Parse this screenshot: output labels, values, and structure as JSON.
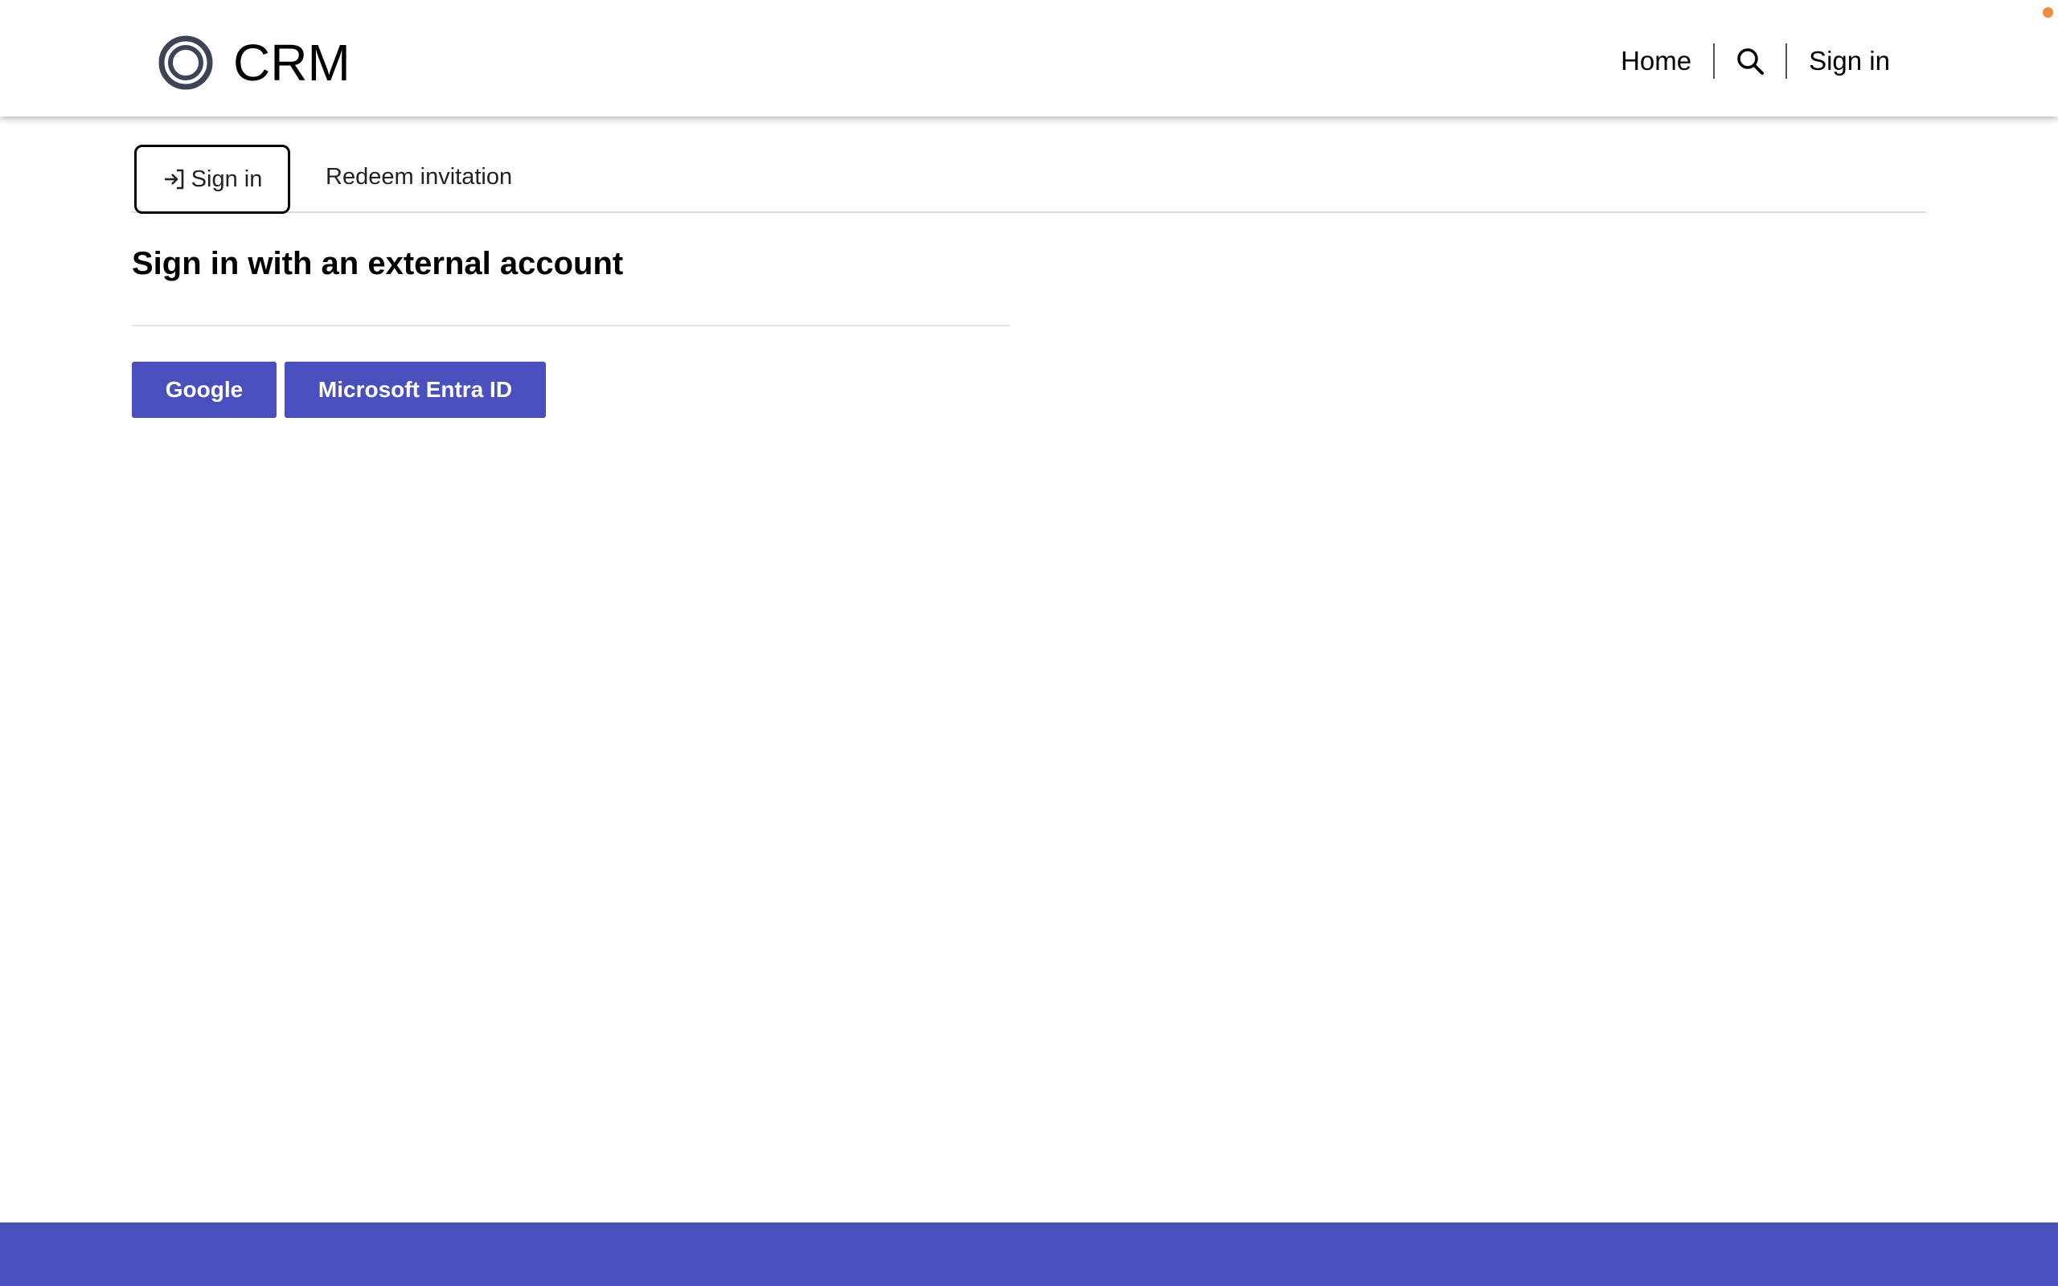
{
  "header": {
    "brand_name": "CRM",
    "logo_icon": "ring-logo-icon",
    "nav": {
      "home_label": "Home",
      "search_icon": "search-icon",
      "signin_label": "Sign in"
    }
  },
  "tabs": {
    "signin_label": "Sign in",
    "signin_icon": "sign-in-arrow-icon",
    "redeem_label": "Redeem invitation",
    "active": "Sign in"
  },
  "main": {
    "heading": "Sign in with an external account",
    "providers": [
      {
        "label": "Google"
      },
      {
        "label": "Microsoft Entra ID"
      }
    ]
  },
  "colors": {
    "accent": "#4a4fbf",
    "logo": "#3c4556",
    "notification_dot": "#f08a3c"
  }
}
